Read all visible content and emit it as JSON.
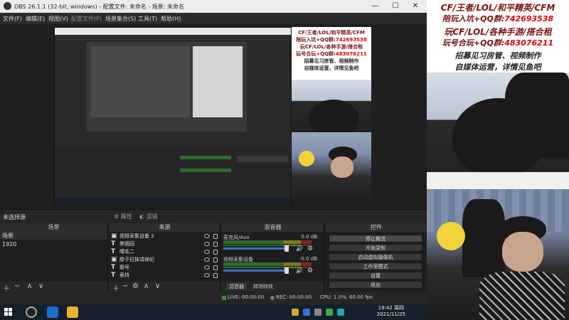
{
  "window": {
    "title": "OBS 26.1.1 (32-bit, windows) - 配置文件: 未命名 - 场景: 未命名",
    "minimize": "—",
    "maximize": "☐",
    "close": "✕"
  },
  "menu": [
    "文件(F)",
    "编辑(E)",
    "视图(V)",
    "配置文件(P)",
    "场景集合(S)",
    "工具(T)",
    "帮助(H)"
  ],
  "overlay": {
    "line1": "CF/王者/LOL/和平精英/CFM",
    "line2_label": "陪玩入坑+QQ群:",
    "line2_num": "742693538",
    "line3": "玩CF/LOL/各种手游/搭合租",
    "line4_label": "玩号合玩+QQ群:",
    "line4_num": "483076211",
    "line5": "招募见习房管、视频制作",
    "line6": "自媒体运营，详情见鱼吧"
  },
  "source_bar": {
    "label": "未选择源",
    "properties": "属性",
    "filters": "滤镜"
  },
  "docks": {
    "scenes_title": "场景",
    "scenes_header": "场景",
    "scenes": [
      "1920"
    ],
    "sources_title": "来源",
    "sources": [
      {
        "icon": "▣",
        "name": "视频采集设备 2"
      },
      {
        "icon": "T",
        "name": "拳圆园"
      },
      {
        "icon": "T",
        "name": "噶毛二"
      },
      {
        "icon": "▣",
        "name": "脖子拉抹请禅纪"
      },
      {
        "icon": "T",
        "name": "聪号"
      },
      {
        "icon": "T",
        "name": "表持"
      }
    ],
    "mixer_title": "混音器",
    "mixer": [
      {
        "name": "麦克风/Aux",
        "db": "0.0 dB"
      },
      {
        "name": "视频采集设备",
        "db": "-0.0 dB"
      }
    ],
    "mixer_tab1": "混音器",
    "mixer_tab2": "转场特效",
    "controls_title": "控件",
    "controls": [
      "停止推流",
      "开始录制",
      "启动虚拟摄像机",
      "工作室模式",
      "设置",
      "退出"
    ]
  },
  "status": {
    "live": "LIVE: 00:00:00",
    "rec": "REC: 00:00:00",
    "cpu": "CPU: 1.0%, 60.00 fps"
  },
  "taskbar": {
    "time": "19:42 周四",
    "date": "2021/11/25"
  },
  "colors": {
    "accent_blue": "#3e73c4",
    "overlay_red": "#e00000",
    "overlay_dark_red": "#7a1010"
  }
}
